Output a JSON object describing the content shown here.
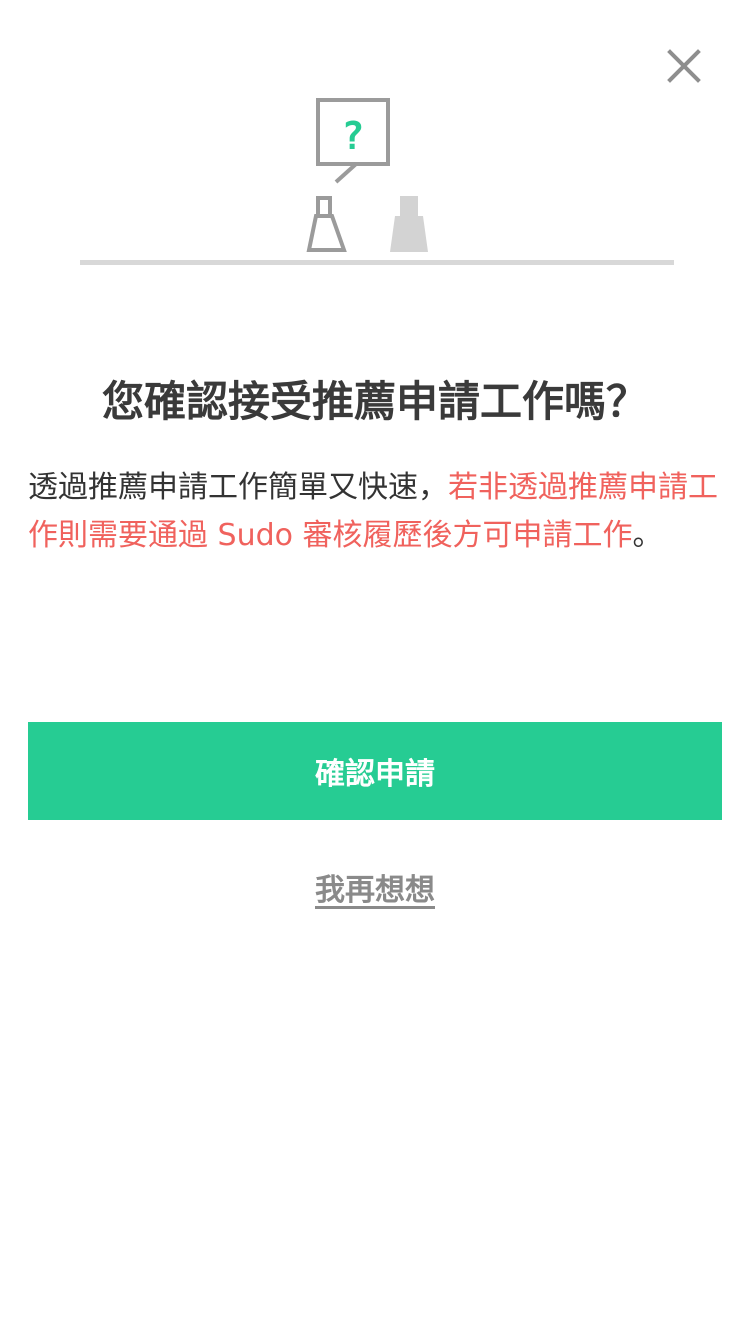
{
  "dialog": {
    "title": "您確認接受推薦申請工作嗎？",
    "description_normal": "透過推薦申請工作簡單又快速，",
    "description_warning": "若非透過推薦申請工作則需要通過 Sudo 審核履歷後方可申請工作",
    "description_end": "。",
    "confirm_label": "確認申請",
    "cancel_label": "我再想想",
    "close_icon": "close-icon",
    "illustration_glyph": "?"
  },
  "colors": {
    "accent": "#26cc93",
    "warning": "#f0625d",
    "muted": "#8a8a8a",
    "icon_gray": "#9b9b9b"
  }
}
